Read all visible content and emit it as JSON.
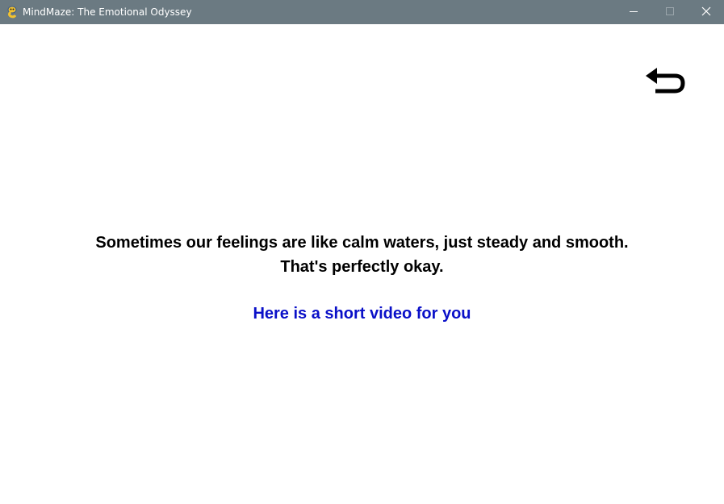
{
  "window": {
    "title": "MindMaze: The Emotional Odyssey",
    "app_icon": "pygame-snake-icon",
    "titlebar_color": "#6b7a82",
    "controls": {
      "minimize_icon": "minimize-icon",
      "maximize_icon": "maximize-icon",
      "close_icon": "close-icon"
    }
  },
  "screen": {
    "back_icon": "back-arrow-icon",
    "message_line_1": "Sometimes our feelings are like calm waters, just steady and smooth.",
    "message_line_2": "That's perfectly okay.",
    "video_link": "Here is a short video for you",
    "text_color": "#000000",
    "link_color": "#0a10c8"
  }
}
